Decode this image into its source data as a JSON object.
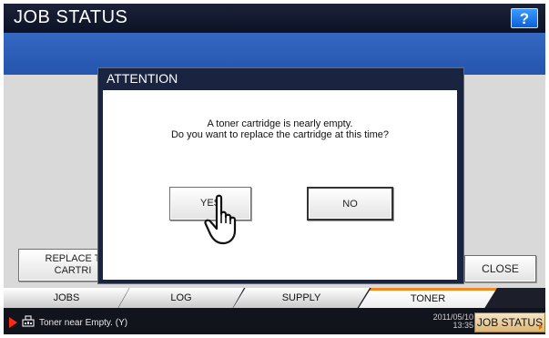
{
  "header": {
    "title": "JOB STATUS",
    "help_label": "?"
  },
  "buttons": {
    "replace_line1": "REPLACE T",
    "replace_line2": "CARTRI",
    "close": "CLOSE"
  },
  "dialog": {
    "title": "ATTENTION",
    "message_line1": "A toner cartridge is nearly empty.",
    "message_line2": "Do you want to replace the cartridge at this time?",
    "yes": "YES",
    "no": "NO"
  },
  "tabs": [
    {
      "label": "JOBS"
    },
    {
      "label": "LOG"
    },
    {
      "label": "SUPPLY"
    },
    {
      "label": "TONER",
      "active": true
    }
  ],
  "statusbar": {
    "message": "Toner near Empty. (Y)",
    "date": "2011/05/10",
    "time": "13:35",
    "job_status": "JOB STATUS"
  },
  "colors": {
    "title_bar": "#0c1226",
    "blue_band": "#2f60b8",
    "accent_orange": "#f08a1e",
    "alert_red": "#ff2a16"
  },
  "icons": [
    "help-icon",
    "alert-arrow-icon",
    "printer-icon",
    "hand-pointer-icon",
    "expand-triangle-icon"
  ]
}
